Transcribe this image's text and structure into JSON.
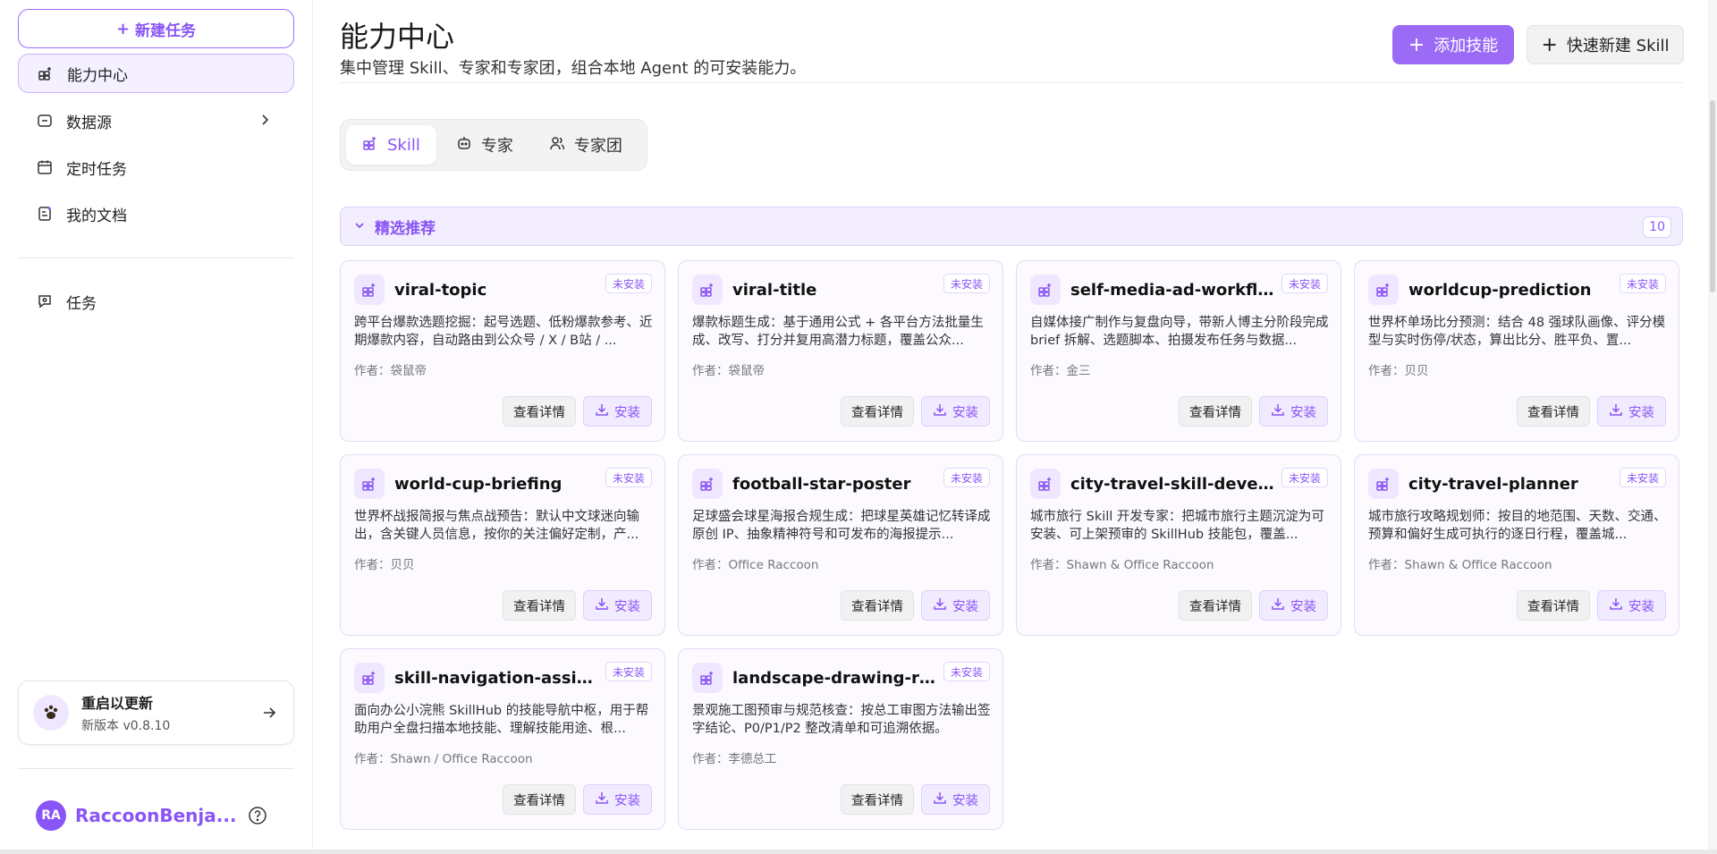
{
  "sidebar": {
    "new_task": "新建任务",
    "items": [
      {
        "label": "能力中心"
      },
      {
        "label": "数据源"
      },
      {
        "label": "定时任务"
      },
      {
        "label": "我的文档"
      },
      {
        "label": "任务"
      }
    ],
    "update": {
      "title": "重启以更新",
      "subtitle": "新版本 v0.8.10"
    },
    "user": {
      "initials": "RA",
      "name": "RaccoonBenja..."
    }
  },
  "header": {
    "title": "能力中心",
    "description": "集中管理 Skill、专家和专家团，组合本地 Agent 的可安装能力。",
    "add_skill": "添加技能",
    "quick_new": "快速新建 Skill"
  },
  "tabs": [
    {
      "label": "Skill"
    },
    {
      "label": "专家"
    },
    {
      "label": "专家团"
    }
  ],
  "section": {
    "title": "精选推荐",
    "count": "10"
  },
  "card_labels": {
    "badge": "未安装",
    "detail": "查看详情",
    "install": "安装"
  },
  "cards": [
    {
      "title": "viral-topic",
      "desc": "跨平台爆款选题挖掘：起号选题、低粉爆款参考、近期爆款内容，自动路由到公众号 / X / B站 / ...",
      "author": "作者：袋鼠帝"
    },
    {
      "title": "viral-title",
      "desc": "爆款标题生成：基于通用公式 + 各平台方法批量生成、改写、打分并复用高潜力标题，覆盖公众...",
      "author": "作者：袋鼠帝"
    },
    {
      "title": "self-media-ad-workflow",
      "desc": "自媒体接广制作与复盘向导，带新人博主分阶段完成 brief 拆解、选题脚本、拍摄发布任务与数据...",
      "author": "作者：金三"
    },
    {
      "title": "worldcup-prediction",
      "desc": "世界杯单场比分预测：结合 48 强球队画像、评分模型与实时伤停/状态，算出比分、胜平负、置...",
      "author": "作者：贝贝"
    },
    {
      "title": "world-cup-briefing",
      "desc": "世界杯战报简报与焦点战预告：默认中文球迷向输出，含关键人员信息，按你的关注偏好定制，产...",
      "author": "作者：贝贝"
    },
    {
      "title": "football-star-poster",
      "desc": "足球盛会球星海报合规生成：把球星英雄记忆转译成原创 IP、抽象精神符号和可发布的海报提示...",
      "author": "作者：Office Raccoon"
    },
    {
      "title": "city-travel-skill-developer",
      "desc": "城市旅行 Skill 开发专家：把城市旅行主题沉淀为可安装、可上架预审的 SkillHub 技能包，覆盖...",
      "author": "作者：Shawn & Office Raccoon"
    },
    {
      "title": "city-travel-planner",
      "desc": "城市旅行攻略规划师：按目的地范围、天数、交通、预算和偏好生成可执行的逐日行程，覆盖城...",
      "author": "作者：Shawn & Office Raccoon"
    },
    {
      "title": "skill-navigation-assistant...",
      "desc": "面向办公小浣熊 SkillHub 的技能导航中枢，用于帮助用户全盘扫描本地技能、理解技能用途、根...",
      "author": "作者：Shawn / Office Raccoon"
    },
    {
      "title": "landscape-drawing-revie...",
      "desc": "景观施工图预审与规范核查：按总工审图方法输出签字结论、P0/P1/P2 整改清单和可追溯依据。",
      "author": "作者：李德总工"
    }
  ],
  "icons": {
    "accent": "#8a55f6",
    "grid_icon": "grid-plus-icon",
    "robot_icon": "robot-icon",
    "users_icon": "users-icon"
  }
}
